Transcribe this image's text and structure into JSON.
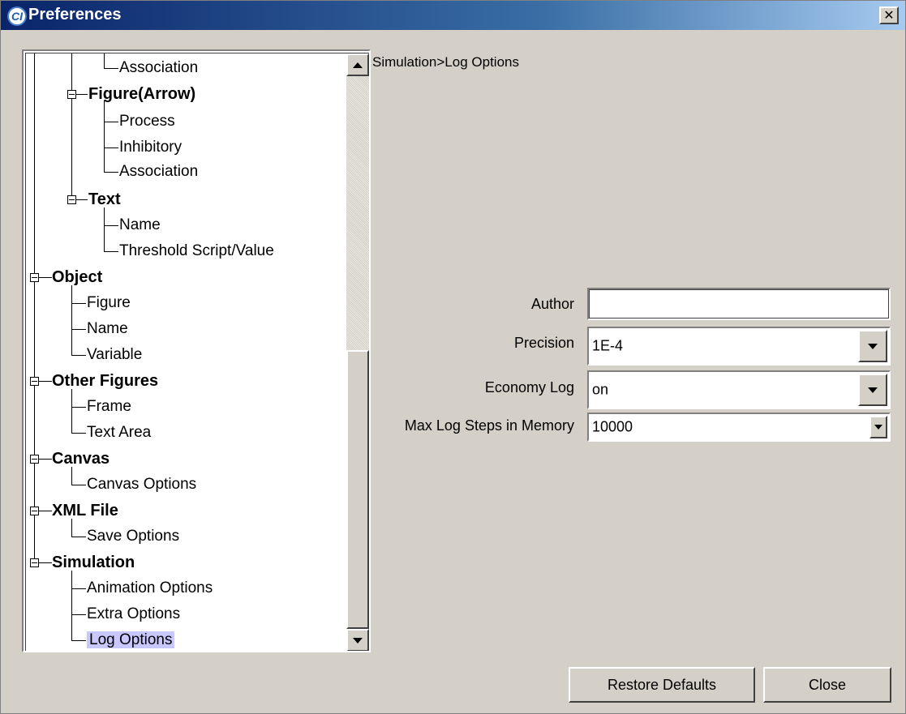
{
  "window": {
    "title": "Preferences",
    "icon": "app-logo-icon",
    "close_glyph": "✕"
  },
  "tree": {
    "items": [
      {
        "label": "Association",
        "bold": false,
        "selected": false
      },
      {
        "label": "Figure(Arrow)",
        "bold": true,
        "selected": false
      },
      {
        "label": "Process",
        "bold": false,
        "selected": false
      },
      {
        "label": "Inhibitory",
        "bold": false,
        "selected": false
      },
      {
        "label": "Association",
        "bold": false,
        "selected": false
      },
      {
        "label": "Text",
        "bold": true,
        "selected": false
      },
      {
        "label": "Name",
        "bold": false,
        "selected": false
      },
      {
        "label": "Threshold Script/Value",
        "bold": false,
        "selected": false
      },
      {
        "label": "Object",
        "bold": true,
        "selected": false
      },
      {
        "label": "Figure",
        "bold": false,
        "selected": false
      },
      {
        "label": "Name",
        "bold": false,
        "selected": false
      },
      {
        "label": "Variable",
        "bold": false,
        "selected": false
      },
      {
        "label": "Other Figures",
        "bold": true,
        "selected": false
      },
      {
        "label": "Frame",
        "bold": false,
        "selected": false
      },
      {
        "label": "Text Area",
        "bold": false,
        "selected": false
      },
      {
        "label": "Canvas",
        "bold": true,
        "selected": false
      },
      {
        "label": "Canvas Options",
        "bold": false,
        "selected": false
      },
      {
        "label": "XML File",
        "bold": true,
        "selected": false
      },
      {
        "label": "Save Options",
        "bold": false,
        "selected": false
      },
      {
        "label": "Simulation",
        "bold": true,
        "selected": false
      },
      {
        "label": "Animation Options",
        "bold": false,
        "selected": false
      },
      {
        "label": "Extra Options",
        "bold": false,
        "selected": false
      },
      {
        "label": "Log Options",
        "bold": false,
        "selected": true
      }
    ],
    "scroll_position_fraction": 0.5
  },
  "panel": {
    "breadcrumb": "Simulation>Log Options",
    "author_label": "Author",
    "author_value": "",
    "precision_label": "Precision",
    "precision_value": "1E-4",
    "economy_label": "Economy Log",
    "economy_value": "on",
    "max_steps_label": "Max Log Steps in Memory",
    "max_steps_value": "10000"
  },
  "buttons": {
    "restore": "Restore Defaults",
    "close": "Close"
  },
  "colors": {
    "title_start": "#0a246a",
    "title_end": "#a6caf0",
    "selection": "#c8c8ff",
    "face": "#d4d0c8"
  }
}
